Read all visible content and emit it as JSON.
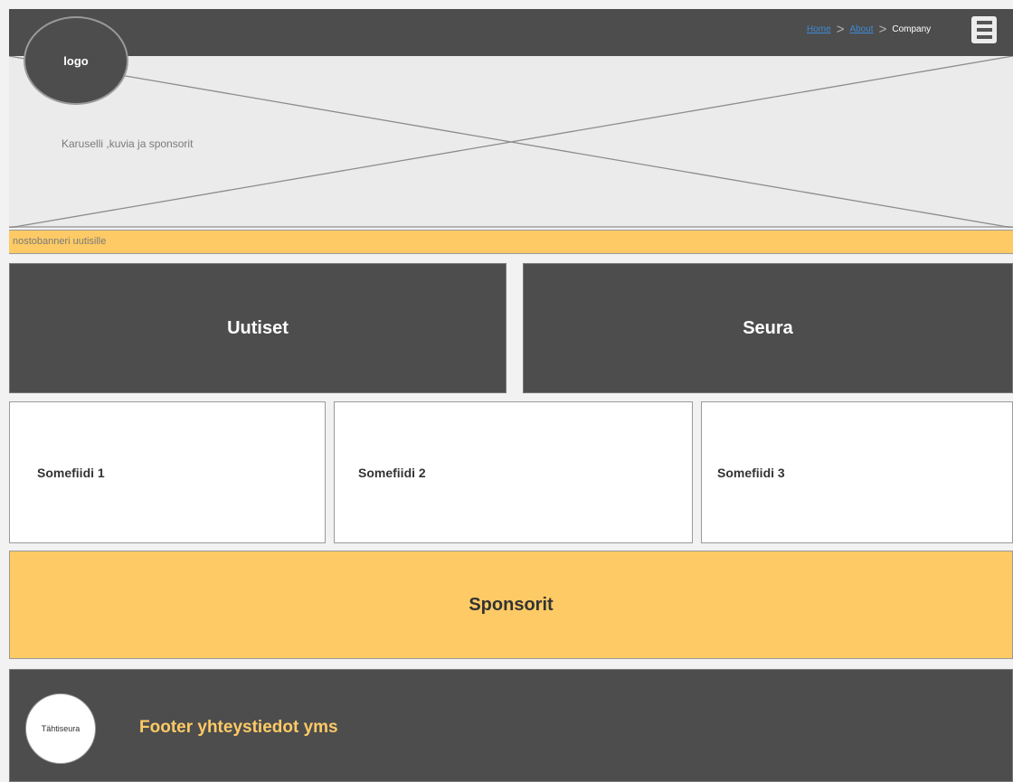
{
  "header": {
    "logo_text": "logo",
    "breadcrumb": {
      "home": "Home",
      "about": "About",
      "current": "Company",
      "separator": ">"
    },
    "menu_icon": "hamburger-menu-icon"
  },
  "hero": {
    "caption": "Karuselli ,kuvia ja sponsorit"
  },
  "news_banner": {
    "label": "nostobanneri uutisille"
  },
  "tiles": {
    "news": "Uutiset",
    "club": "Seura"
  },
  "feeds": {
    "feed1": "Somefiidi 1",
    "feed2": "Somefiidi 2",
    "feed3": "Somefiidi 3"
  },
  "sponsors": {
    "label": "Sponsorit"
  },
  "footer": {
    "badge_text": "Tähtiseura",
    "text": "Footer yhteystiedot yms"
  },
  "colors": {
    "dark": "#4d4d4d",
    "accent": "#fdca65",
    "placeholder_bg": "#ebebeb",
    "link": "#3d8ad6"
  }
}
